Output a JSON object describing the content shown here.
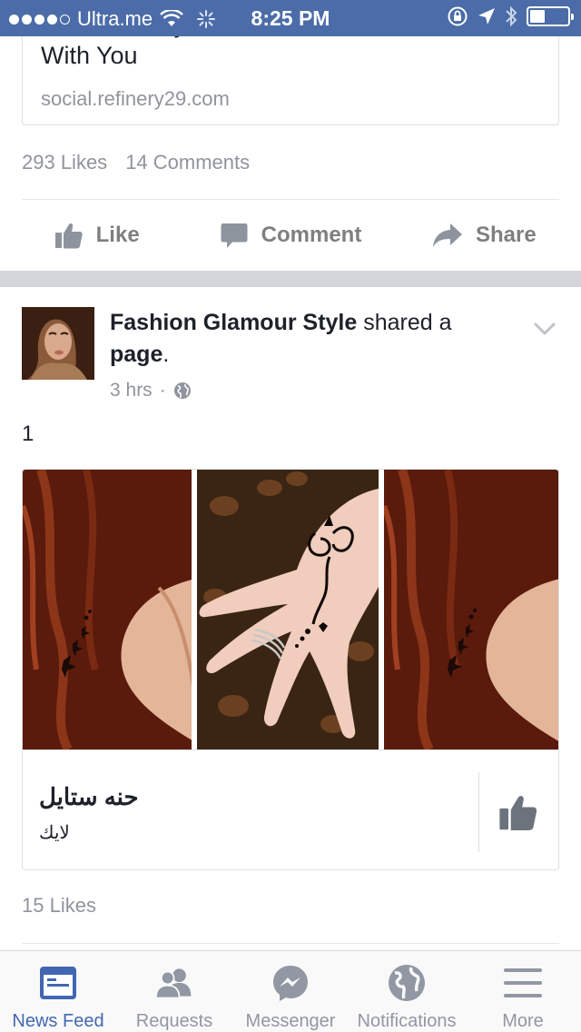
{
  "status_bar": {
    "carrier": "Ultra.me",
    "time": "8:25 PM",
    "signal_bars": 4,
    "signal_total": 5,
    "battery_level": 0.35
  },
  "previous_post": {
    "link_title_partial": "Ron Weasley Is So Nice He'll Go Home",
    "link_title_line2": "With You",
    "link_domain": "social.refinery29.com",
    "likes": "293 Likes",
    "comments": "14 Comments",
    "actions": {
      "like": "Like",
      "comment": "Comment",
      "share": "Share"
    }
  },
  "post": {
    "author": "Fashion Glamour Style",
    "action_text": "shared a",
    "object": "page",
    "period": ".",
    "time": "3 hrs",
    "separator": "·",
    "privacy_icon": "globe-icon",
    "text": "1",
    "shared_page": {
      "name": "حنه ستايل",
      "subtitle": "لايك"
    },
    "likes": "15 Likes"
  },
  "tab_bar": {
    "tabs": [
      {
        "label": "News Feed",
        "icon": "news-feed-icon",
        "active": true
      },
      {
        "label": "Requests",
        "icon": "friend-requests-icon",
        "active": false
      },
      {
        "label": "Messenger",
        "icon": "messenger-icon",
        "active": false
      },
      {
        "label": "Notifications",
        "icon": "globe-icon",
        "active": false
      },
      {
        "label": "More",
        "icon": "menu-icon",
        "active": false
      }
    ]
  },
  "colors": {
    "brand": "#4b6ca8",
    "active_tab": "#4267b2",
    "meta_text": "#90949c"
  }
}
